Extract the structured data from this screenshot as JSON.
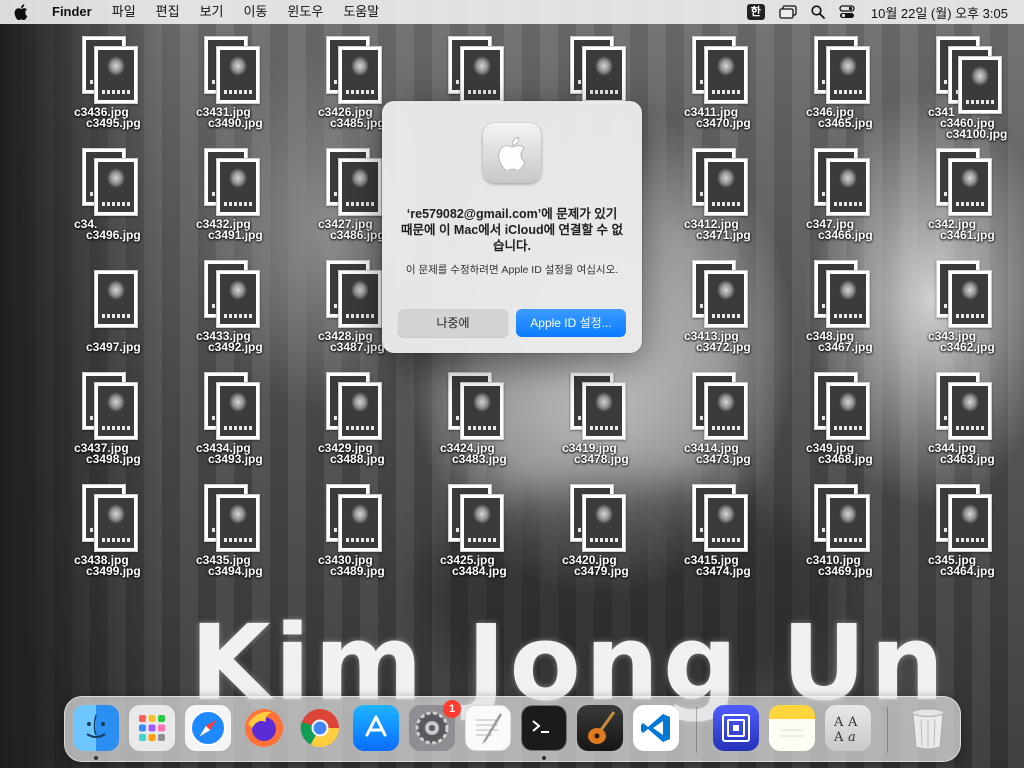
{
  "menubar": {
    "app_name": "Finder",
    "menus": [
      "파일",
      "편집",
      "보기",
      "이동",
      "윈도우",
      "도움말"
    ],
    "input_method": "한",
    "clock": "10월 22일 (월) 오후 3:05"
  },
  "wallpaper": {
    "caption": "Kim Jong Un"
  },
  "desktop_files": [
    {
      "a": "c3436.jpg",
      "b": "c3495.jpg"
    },
    {
      "a": "c3431.jpg",
      "b": "c3490.jpg"
    },
    {
      "a": "c3426.jpg",
      "b": "c3485.jpg"
    },
    {
      "a": "",
      "b": ""
    },
    {
      "a": "",
      "b": ""
    },
    {
      "a": "c3411.jpg",
      "b": "c3470.jpg"
    },
    {
      "a": "c346.jpg",
      "b": "c3465.jpg"
    },
    {
      "a": "c341",
      "b": "c3460.jpg",
      "c": "c34100.jpg"
    },
    {
      "a": "c34.",
      "b": "c3496.jpg"
    },
    {
      "a": "c3432.jpg",
      "b": "c3491.jpg"
    },
    {
      "a": "c3427.jpg",
      "b": "c3486.jpg"
    },
    {
      "a": "c3412.jpg",
      "b": "c3471.jpg"
    },
    {
      "a": "c347.jpg",
      "b": "c3466.jpg"
    },
    {
      "a": "c342.jpg",
      "b": "c3461.jpg"
    },
    {
      "a": "",
      "b": "c3497.jpg"
    },
    {
      "a": "c3433.jpg",
      "b": "c3492.jpg"
    },
    {
      "a": "c3428.jpg",
      "b": "c3487.jpg"
    },
    {
      "a": "c3413.jpg",
      "b": "c3472.jpg"
    },
    {
      "a": "c348.jpg",
      "b": "c3467.jpg"
    },
    {
      "a": "c343.jpg",
      "b": "c3462.jpg"
    },
    {
      "a": "c3437.jpg",
      "b": "c3498.jpg"
    },
    {
      "a": "c3434.jpg",
      "b": "c3493.jpg"
    },
    {
      "a": "c3429.jpg",
      "b": "c3488.jpg"
    },
    {
      "a": "c3424.jpg",
      "b": "c3483.jpg"
    },
    {
      "a": "c3419.jpg",
      "b": "c3478.jpg"
    },
    {
      "a": "c3414.jpg",
      "b": "c3473.jpg"
    },
    {
      "a": "c349.jpg",
      "b": "c3468.jpg"
    },
    {
      "a": "c344.jpg",
      "b": "c3463.jpg"
    },
    {
      "a": "c3438.jpg",
      "b": "c3499.jpg"
    },
    {
      "a": "c3435.jpg",
      "b": "c3494.jpg"
    },
    {
      "a": "c3430.jpg",
      "b": "c3489.jpg"
    },
    {
      "a": "c3425.jpg",
      "b": "c3484.jpg"
    },
    {
      "a": "c3420.jpg",
      "b": "c3479.jpg"
    },
    {
      "a": "c3415.jpg",
      "b": "c3474.jpg"
    },
    {
      "a": "c3410.jpg",
      "b": "c3469.jpg"
    },
    {
      "a": "c345.jpg",
      "b": "c3464.jpg"
    }
  ],
  "dialog": {
    "title": "‘re579082@gmail.com’에 문제가 있기 때문에 이 Mac에서 iCloud에 연결할 수 없습니다.",
    "message": "이 문제를 수정하려면 Apple ID 설정을 여십시오.",
    "later_button": "나중에",
    "settings_button": "Apple ID 설정..."
  },
  "dock": {
    "apps": [
      "Finder",
      "Launchpad",
      "Safari",
      "Firefox",
      "Chrome",
      "App Store",
      "System Preferences",
      "TextEdit",
      "Terminal",
      "GarageBand",
      "Visual Studio Code",
      "Remote Desktop",
      "Notes",
      "Font Book",
      "Trash"
    ],
    "system_prefs_badge": "1"
  }
}
